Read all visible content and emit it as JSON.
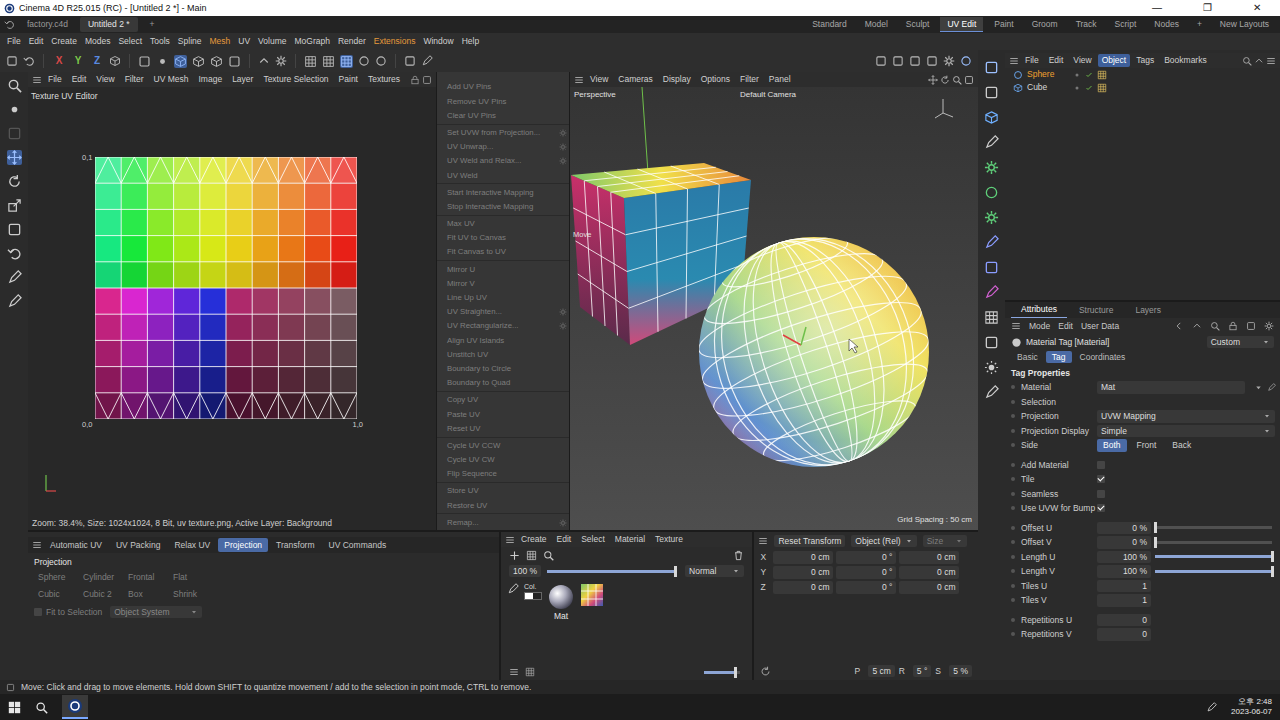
{
  "window": {
    "title": "Cinema 4D R25.015 (RC) - [Untitled 2 *] - Main",
    "controls": [
      "—",
      "❐",
      "✕"
    ]
  },
  "doc_tabs": [
    {
      "label": "factory.c4d",
      "selected": false
    },
    {
      "label": "Untitled 2 *",
      "selected": true
    }
  ],
  "doc_tab_add": "+",
  "layouts": [
    {
      "label": "Standard",
      "selected": false
    },
    {
      "label": "Model",
      "selected": false
    },
    {
      "label": "Sculpt",
      "selected": false
    },
    {
      "label": "UV Edit",
      "selected": true
    },
    {
      "label": "Paint",
      "selected": false
    },
    {
      "label": "Groom",
      "selected": false
    },
    {
      "label": "Track",
      "selected": false
    },
    {
      "label": "Script",
      "selected": false
    },
    {
      "label": "Nodes",
      "selected": false
    },
    {
      "label": "+",
      "selected": false
    },
    {
      "label": "New Layouts",
      "selected": false
    }
  ],
  "menu": [
    {
      "label": "File",
      "highlighted": false
    },
    {
      "label": "Edit",
      "highlighted": false
    },
    {
      "label": "Create",
      "highlighted": false
    },
    {
      "label": "Modes",
      "highlighted": false
    },
    {
      "label": "Select",
      "highlighted": false
    },
    {
      "label": "Tools",
      "highlighted": false
    },
    {
      "label": "Spline",
      "highlighted": false
    },
    {
      "label": "Mesh",
      "highlighted": true
    },
    {
      "label": "UV",
      "highlighted": false
    },
    {
      "label": "Volume",
      "highlighted": false
    },
    {
      "label": "MoGraph",
      "highlighted": false
    },
    {
      "label": "Render",
      "highlighted": false
    },
    {
      "label": "Extensions",
      "highlighted": true
    },
    {
      "label": "Window",
      "highlighted": false
    },
    {
      "label": "Help",
      "highlighted": false
    }
  ],
  "toolbar": {
    "axes": [
      {
        "label": "X",
        "color": "#d94848"
      },
      {
        "label": "Y",
        "color": "#7cc84a"
      },
      {
        "label": "Z",
        "color": "#5a8ae0"
      }
    ]
  },
  "uv_editor": {
    "menu": [
      "File",
      "Edit",
      "View",
      "Filter",
      "UV Mesh",
      "Image",
      "Layer",
      "Texture Selection",
      "Paint",
      "Textures"
    ],
    "title": "Texture UV Editor",
    "axis_labels": {
      "top_left": "0,1",
      "bottom_left": "0,0",
      "bottom_right": "1,0"
    },
    "status": "Zoom: 38.4%, Size: 1024x1024, 8 Bit, uv texture.png, Active Layer: Background"
  },
  "uv_commands": {
    "groups": [
      [
        {
          "label": "Add UV Pins",
          "disabled": true,
          "options": false
        },
        {
          "label": "Remove UV Pins",
          "disabled": true,
          "options": false
        },
        {
          "label": "Clear UV Pins",
          "disabled": true,
          "options": false
        }
      ],
      [
        {
          "label": "Set UVW from Projection...",
          "disabled": true,
          "options": true
        },
        {
          "label": "UV Unwrap...",
          "disabled": true,
          "options": true
        },
        {
          "label": "UV Weld and Relax...",
          "disabled": true,
          "options": true
        },
        {
          "label": "UV Weld",
          "disabled": true,
          "options": false
        }
      ],
      [
        {
          "label": "Start Interactive Mapping",
          "disabled": true,
          "options": false
        },
        {
          "label": "Stop Interactive Mapping",
          "disabled": true,
          "options": false
        }
      ],
      [
        {
          "label": "Max UV",
          "disabled": true,
          "options": false
        },
        {
          "label": "Fit UV to Canvas",
          "disabled": true,
          "options": false
        },
        {
          "label": "Fit Canvas to UV",
          "disabled": true,
          "options": false
        }
      ],
      [
        {
          "label": "Mirror U",
          "disabled": true,
          "options": false
        },
        {
          "label": "Mirror V",
          "disabled": true,
          "options": false
        },
        {
          "label": "Line Up UV",
          "disabled": true,
          "options": false
        },
        {
          "label": "UV Straighten...",
          "disabled": true,
          "options": true
        },
        {
          "label": "UV Rectangularize...",
          "disabled": true,
          "options": true
        },
        {
          "label": "Align UV Islands",
          "disabled": true,
          "options": false
        },
        {
          "label": "Unstitch UV",
          "disabled": true,
          "options": false
        },
        {
          "label": "Boundary to Circle",
          "disabled": true,
          "options": false
        },
        {
          "label": "Boundary to Quad",
          "disabled": true,
          "options": false
        }
      ],
      [
        {
          "label": "Copy UV",
          "disabled": true,
          "options": false
        },
        {
          "label": "Paste UV",
          "disabled": true,
          "options": false
        },
        {
          "label": "Reset UV",
          "disabled": true,
          "options": false
        }
      ],
      [
        {
          "label": "Cycle UV CCW",
          "disabled": true,
          "options": false
        },
        {
          "label": "Cycle UV CW",
          "disabled": true,
          "options": false
        },
        {
          "label": "Flip Sequence",
          "disabled": true,
          "options": false
        }
      ],
      [
        {
          "label": "Store UV",
          "disabled": true,
          "options": false
        },
        {
          "label": "Restore UV",
          "disabled": true,
          "options": false
        }
      ],
      [
        {
          "label": "Remap...",
          "disabled": true,
          "options": true
        }
      ]
    ]
  },
  "viewport": {
    "menu": [
      "View",
      "Cameras",
      "Display",
      "Options",
      "Filter",
      "Panel"
    ],
    "camera_view": "Perspective",
    "camera": "Default Camera",
    "grid_spacing": "Grid Spacing : 50 cm",
    "tool_hint": "Move"
  },
  "object_manager": {
    "menu": [
      {
        "label": "File",
        "selected": false
      },
      {
        "label": "Edit",
        "selected": false
      },
      {
        "label": "View",
        "selected": false
      },
      {
        "label": "Object",
        "selected": true
      },
      {
        "label": "Tags",
        "selected": false
      },
      {
        "label": "Bookmarks",
        "selected": false
      }
    ],
    "objects": [
      {
        "name": "Sphere",
        "selected": true
      },
      {
        "name": "Cube",
        "selected": false
      }
    ]
  },
  "attributes": {
    "panel_tabs": [
      {
        "label": "Attributes",
        "selected": true
      },
      {
        "label": "Structure",
        "selected": false
      },
      {
        "label": "Layers",
        "selected": false
      }
    ],
    "menu": [
      "Mode",
      "Edit",
      "User Data"
    ],
    "title": "Material Tag [Material]",
    "preset": "Custom",
    "tabs": [
      {
        "label": "Basic",
        "selected": false
      },
      {
        "label": "Tag",
        "selected": true
      },
      {
        "label": "Coordinates",
        "selected": false
      }
    ],
    "section": "Tag Properties",
    "groups": [
      [
        {
          "label": "Material",
          "kind": "link",
          "value": "Mat"
        },
        {
          "label": "Selection",
          "kind": "empty"
        },
        {
          "label": "Projection",
          "kind": "dropdown",
          "value": "UVW Mapping"
        },
        {
          "label": "Projection Display",
          "kind": "dropdown",
          "value": "Simple"
        },
        {
          "label": "Side",
          "kind": "segmented",
          "options": [
            {
              "label": "Both",
              "selected": true
            },
            {
              "label": "Front",
              "selected": false
            },
            {
              "label": "Back",
              "selected": false
            }
          ]
        }
      ],
      [
        {
          "label": "Add Material",
          "kind": "checkbox",
          "checked": false
        },
        {
          "label": "Tile",
          "kind": "checkbox",
          "checked": true
        },
        {
          "label": "Seamless",
          "kind": "checkbox",
          "checked": false
        },
        {
          "label": "Use UVW for Bump",
          "kind": "checkbox",
          "checked": true
        }
      ],
      [
        {
          "label": "Offset U",
          "kind": "slider",
          "value": "0 %",
          "level": 0
        },
        {
          "label": "Offset V",
          "kind": "slider",
          "value": "0 %",
          "level": 0
        },
        {
          "label": "Length U",
          "kind": "slider",
          "value": "100 %",
          "level": 1
        },
        {
          "label": "Length V",
          "kind": "slider",
          "value": "100 %",
          "level": 1
        },
        {
          "label": "Tiles U",
          "kind": "number",
          "value": "1"
        },
        {
          "label": "Tiles V",
          "kind": "number",
          "value": "1"
        }
      ],
      [
        {
          "label": "Repetitions U",
          "kind": "number",
          "value": "0"
        },
        {
          "label": "Repetitions V",
          "kind": "number",
          "value": "0"
        }
      ]
    ]
  },
  "bottom_panel": {
    "tabs": [
      {
        "label": "Automatic UV",
        "selected": false
      },
      {
        "label": "UV Packing",
        "selected": false
      },
      {
        "label": "Relax UV",
        "selected": false
      },
      {
        "label": "Projection",
        "selected": true
      },
      {
        "label": "Transform",
        "selected": false
      },
      {
        "label": "UV Commands",
        "selected": false
      }
    ],
    "heading": "Projection",
    "buttons": [
      {
        "label": "Sphere",
        "disabled": true
      },
      {
        "label": "Cylinder",
        "disabled": true
      },
      {
        "label": "Frontal",
        "disabled": true
      },
      {
        "label": "Flat",
        "disabled": true
      },
      {
        "label": "Cubic",
        "disabled": true
      },
      {
        "label": "Cubic 2",
        "disabled": true
      },
      {
        "label": "Box",
        "disabled": true
      },
      {
        "label": "Shrink",
        "disabled": true
      }
    ],
    "fit_to_selection": {
      "label": "Fit to Selection",
      "checked": false
    },
    "system": "Object System"
  },
  "material_manager": {
    "menu": [
      "Create",
      "Edit",
      "Select",
      "Material",
      "Texture"
    ],
    "zoom": {
      "reading": "100 %",
      "level": 1
    },
    "blend": "Normal",
    "swatch_label": "Col.",
    "materials": [
      {
        "name": "Mat",
        "selected": false
      }
    ],
    "thumb_size_level": 0.85
  },
  "coordinates": {
    "reset": "Reset Transform",
    "mode": "Object (Rel)",
    "size_mode": "Size",
    "rows": [
      {
        "axis": "X",
        "position": "0 cm",
        "rotation": "0 °",
        "size": "0 cm"
      },
      {
        "axis": "Y",
        "position": "0 cm",
        "rotation": "0 °",
        "size": "0 cm"
      },
      {
        "axis": "Z",
        "position": "0 cm",
        "rotation": "0 °",
        "size": "0 cm"
      }
    ],
    "steps": [
      {
        "label": "P",
        "value": "5 cm"
      },
      {
        "label": "R",
        "value": "5 °"
      },
      {
        "label": "S",
        "value": "5 %"
      }
    ]
  },
  "status_bar": "Move: Click and drag to move elements. Hold down SHIFT to quantize movement / add to the selection in point mode, CTRL to remove.",
  "taskbar": {
    "time": "오후 2:48",
    "date": "2023-06-07"
  }
}
